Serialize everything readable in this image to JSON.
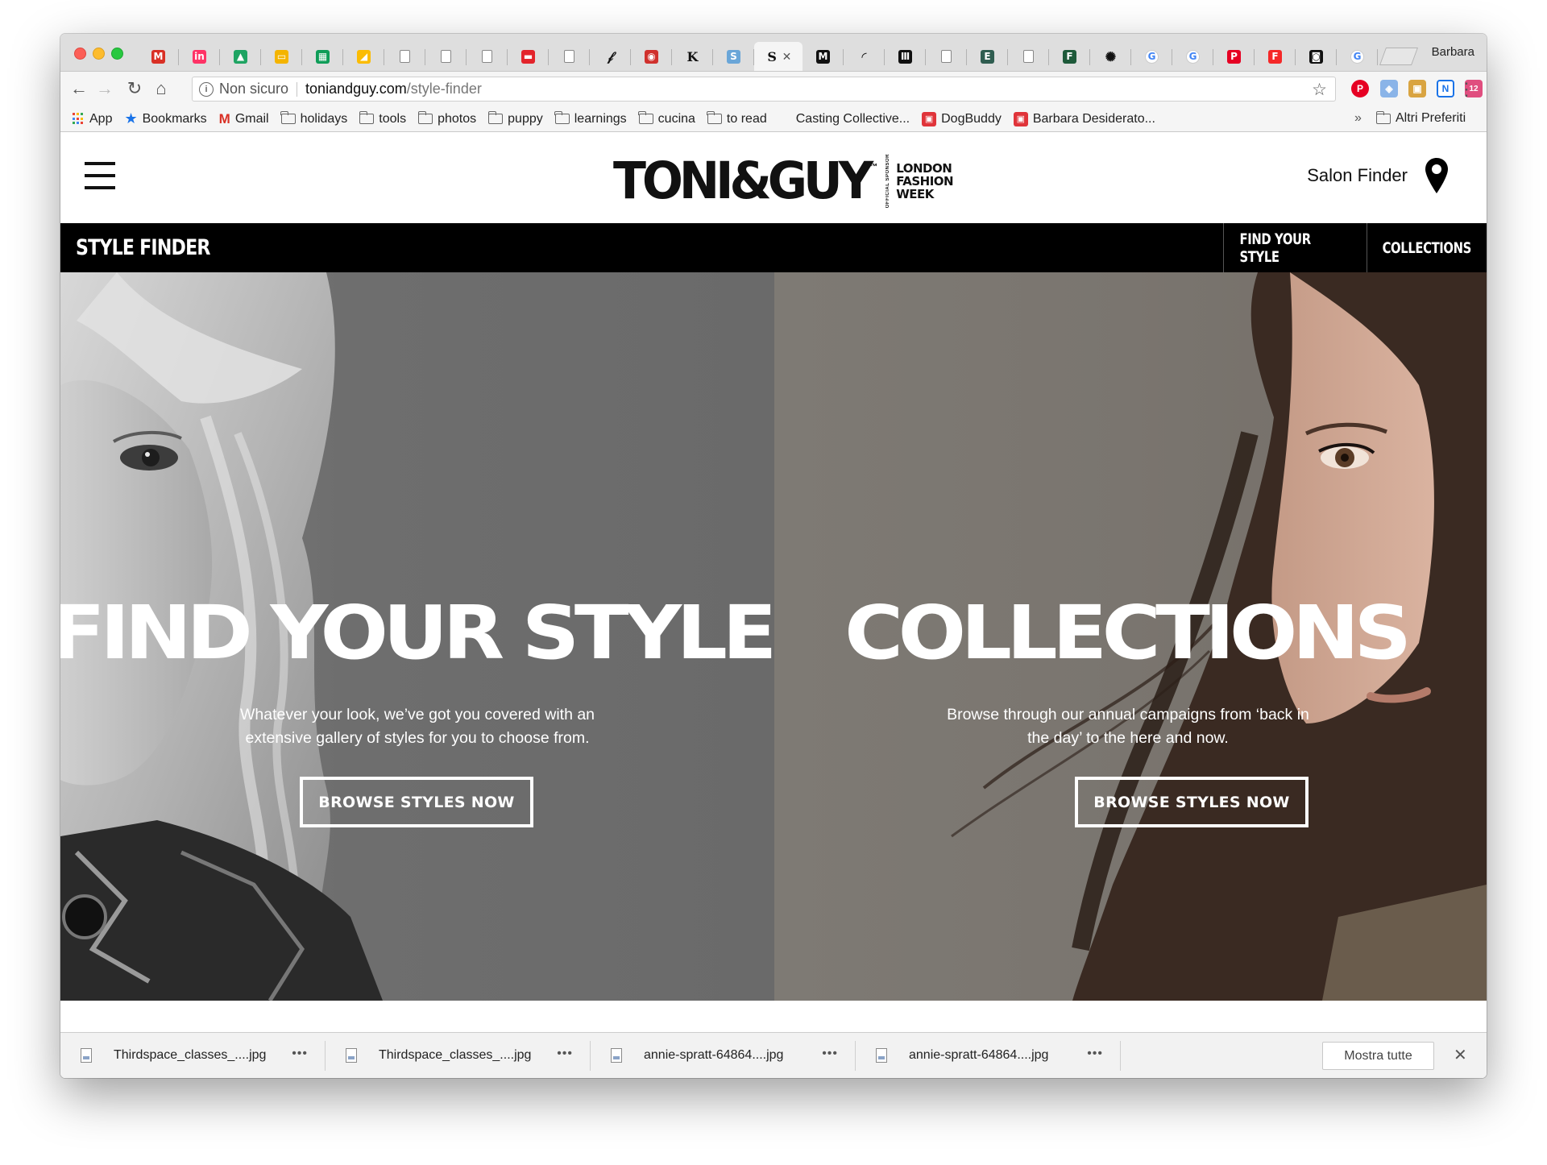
{
  "browser": {
    "profile_name": "Barbara",
    "tabs": [
      {
        "icon": "gmail-icon",
        "glyph": "M",
        "color": "#d93025"
      },
      {
        "icon": "invision-icon",
        "glyph": "in",
        "color": "#ff3366"
      },
      {
        "icon": "google-drive-icon",
        "glyph": "▲",
        "color": "#1fa463"
      },
      {
        "icon": "google-slides-icon",
        "glyph": "▭",
        "color": "#f4b400"
      },
      {
        "icon": "google-sheets-icon",
        "glyph": "▦",
        "color": "#0f9d58"
      },
      {
        "icon": "google-keep-icon",
        "glyph": "◢",
        "color": "#fbbc04"
      },
      {
        "icon": "document-icon",
        "glyph": "",
        "color": "#ffffff"
      },
      {
        "icon": "document-icon",
        "glyph": "",
        "color": "#ffffff"
      },
      {
        "icon": "document-icon",
        "glyph": "",
        "color": "#ffffff"
      },
      {
        "icon": "red-logo-icon",
        "glyph": "▬",
        "color": "#e3242b"
      },
      {
        "icon": "document-icon",
        "glyph": "",
        "color": "#ffffff"
      },
      {
        "icon": "quill-icon",
        "glyph": "𝒻",
        "color": "transparent"
      },
      {
        "icon": "red-circle-icon",
        "glyph": "◉",
        "color": "#d0312d"
      },
      {
        "icon": "k-letter-icon",
        "glyph": "K",
        "color": "transparent"
      },
      {
        "icon": "s-logo-icon",
        "glyph": "S",
        "color": "#6aa6d8"
      },
      {
        "icon": "active-tab-icon",
        "glyph": "S",
        "color": "transparent",
        "active": true
      },
      {
        "icon": "m-logo-icon",
        "glyph": "M",
        "color": "#111111"
      },
      {
        "icon": "loading-icon",
        "glyph": "◜",
        "color": "transparent"
      },
      {
        "icon": "bars-logo-icon",
        "glyph": "Ⅲ",
        "color": "#111111"
      },
      {
        "icon": "document-icon",
        "glyph": "",
        "color": "#ffffff"
      },
      {
        "icon": "em-logo-icon",
        "glyph": "E",
        "color": "#2f5d50"
      },
      {
        "icon": "document-icon",
        "glyph": "",
        "color": "#ffffff"
      },
      {
        "icon": "green-logo-icon",
        "glyph": "F",
        "color": "#1e5a3a"
      },
      {
        "icon": "flower-icon",
        "glyph": "✺",
        "color": "transparent"
      },
      {
        "icon": "google-icon",
        "glyph": "G",
        "color": "#ffffff"
      },
      {
        "icon": "google-icon",
        "glyph": "G",
        "color": "#ffffff"
      },
      {
        "icon": "pinterest-icon",
        "glyph": "P",
        "color": "#e60023"
      },
      {
        "icon": "flipboard-icon",
        "glyph": "F",
        "color": "#f52828"
      },
      {
        "icon": "camera-icon",
        "glyph": "◙",
        "color": "#111111"
      },
      {
        "icon": "google-icon",
        "glyph": "G",
        "color": "#ffffff"
      }
    ],
    "address": {
      "security_label": "Non sicuro",
      "host": "toniandguy.com",
      "path": "/style-finder"
    },
    "bookmarks": [
      {
        "icon": "apps-grid-icon",
        "label": "App"
      },
      {
        "icon": "star-icon",
        "label": "Bookmarks"
      },
      {
        "icon": "gmail-icon",
        "label": "Gmail"
      },
      {
        "icon": "folder-icon",
        "label": "holidays"
      },
      {
        "icon": "folder-icon",
        "label": "tools"
      },
      {
        "icon": "folder-icon",
        "label": "photos"
      },
      {
        "icon": "folder-icon",
        "label": "puppy"
      },
      {
        "icon": "folder-icon",
        "label": "learnings"
      },
      {
        "icon": "folder-icon",
        "label": "cucina"
      },
      {
        "icon": "folder-icon",
        "label": "to read"
      },
      {
        "icon": "none",
        "label": "Casting Collective..."
      },
      {
        "icon": "dogbuddy-icon",
        "label": "DogBuddy"
      },
      {
        "icon": "red-square-icon",
        "label": "Barbara Desiderato..."
      }
    ],
    "bookmarks_overflow": "»",
    "other_bookmarks": "Altri Preferiti"
  },
  "site": {
    "logo_text": "TONI&GUY",
    "logo_tm": "™",
    "logo_vertical": "OFFICIAL SPONSOR",
    "logo_lfw": [
      "LONDON",
      "FASHION",
      "WEEK"
    ],
    "salon_finder": "Salon Finder",
    "subnav": {
      "title": "STYLE FINDER",
      "links": [
        "FIND YOUR STYLE",
        "COLLECTIONS"
      ]
    },
    "panels": [
      {
        "title": "FIND YOUR STYLE",
        "text": "Whatever your look, we’ve got you covered with an extensive gallery of styles for you to choose from.",
        "button": "BROWSE STYLES NOW"
      },
      {
        "title": "COLLECTIONS",
        "text": "Browse through our annual campaigns from ‘back in the day’ to the here and now.",
        "button": "BROWSE STYLES NOW"
      }
    ]
  },
  "downloads": {
    "items": [
      {
        "name": "Thirdspace_classes_....jpg"
      },
      {
        "name": "Thirdspace_classes_....jpg"
      },
      {
        "name": "annie-spratt-64864....jpg"
      },
      {
        "name": "annie-spratt-64864....jpg"
      }
    ],
    "more_label": "•••",
    "show_all": "Mostra tutte",
    "close": "✕"
  }
}
